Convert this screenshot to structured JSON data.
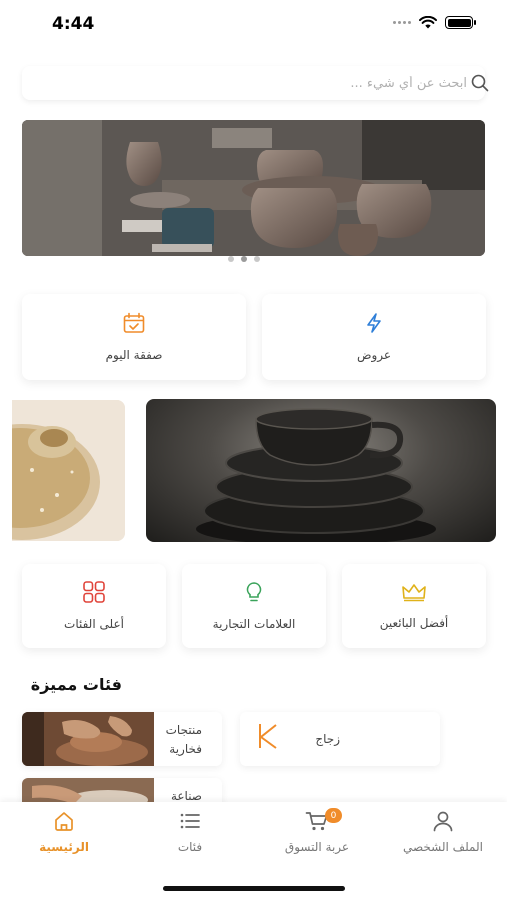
{
  "status_bar": {
    "time": "4:44"
  },
  "search": {
    "placeholder": "ابحث عن أي شيء ..."
  },
  "carousel": {
    "dot_count": 3,
    "active_index": 1
  },
  "quick_actions": [
    {
      "label": "عروض",
      "icon": "lightning-icon"
    },
    {
      "label": "صفقة اليوم",
      "icon": "calendar-check-icon"
    }
  ],
  "category_shortcuts": [
    {
      "label": "أفضل البائعين",
      "icon": "crown-icon"
    },
    {
      "label": "العلامات التجارية",
      "icon": "lightbulb-icon"
    },
    {
      "label": "أعلى الفئات",
      "icon": "grid-icon"
    }
  ],
  "featured": {
    "title": "فئات مميزة",
    "items": [
      {
        "label": "منتجات فخارية",
        "line1": "منتجات",
        "line2": "فخارية"
      },
      {
        "label": "زجاج"
      },
      {
        "label": "صناعة",
        "line1": "صناعة"
      }
    ]
  },
  "bottom_nav": {
    "items": [
      {
        "label": "الرئيسية",
        "icon": "home-icon",
        "active": true
      },
      {
        "label": "فئات",
        "icon": "list-icon",
        "active": false
      },
      {
        "label": "عربة التسوق",
        "icon": "cart-icon",
        "active": false,
        "badge": "0"
      },
      {
        "label": "الملف الشخصي",
        "icon": "user-icon",
        "active": false
      }
    ]
  },
  "colors": {
    "accent": "#f08c2a",
    "blue_icon": "#2f7fd8",
    "red_icon": "#e0443a",
    "green_icon": "#3aa35a",
    "gold_icon": "#e0b21a"
  }
}
